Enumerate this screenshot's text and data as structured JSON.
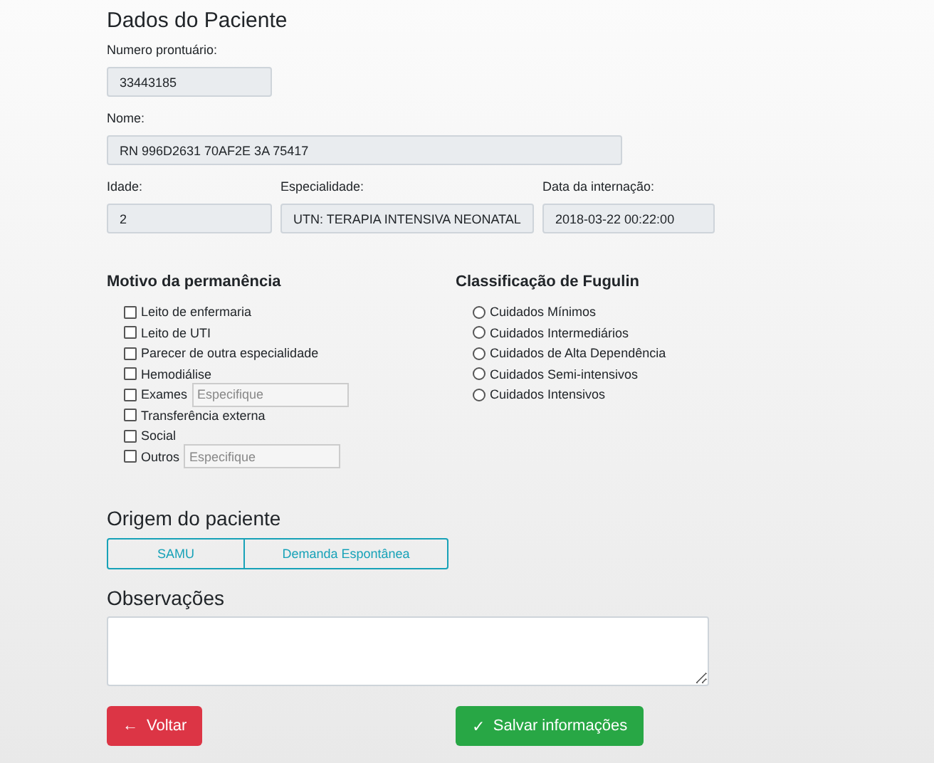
{
  "title": "Dados do Paciente",
  "fields": [
    {
      "label": "Numero prontuário:",
      "value": "33443185"
    },
    {
      "label": "Nome:",
      "value": "RN 996D2631 70AF2E 3A 75417"
    }
  ],
  "fields_row": [
    {
      "label": "Idade:",
      "value": "2"
    },
    {
      "label": "Especialidade:",
      "value": "UTN: TERAPIA INTENSIVA NEONATAL"
    },
    {
      "label": "Data da internação:",
      "value": "2018-03-22 00:22:00"
    }
  ],
  "motivo": {
    "heading": "Motivo da permanência",
    "items": [
      {
        "label": "Leito de enfermaria",
        "checked": false,
        "kind": "checkbox"
      },
      {
        "label": "Leito de UTI",
        "checked": false,
        "kind": "checkbox"
      },
      {
        "label": "Parecer de outra especialidade",
        "checked": false,
        "kind": "checkbox"
      },
      {
        "label": "Hemodiálise",
        "checked": false,
        "kind": "checkbox"
      },
      {
        "label": "Exames",
        "checked": false,
        "kind": "with-field",
        "placeholder": "Especifique"
      },
      {
        "label": "Transferência externa",
        "checked": false,
        "kind": "checkbox"
      },
      {
        "label": "Social",
        "checked": false,
        "kind": "checkbox"
      },
      {
        "label": "Outros",
        "checked": false,
        "kind": "with-field",
        "placeholder": "Especifique"
      }
    ]
  },
  "fugulin": {
    "heading": "Classificação de Fugulin",
    "options": [
      {
        "label": "Cuidados Mínimos",
        "selected": false
      },
      {
        "label": "Cuidados Intermediários",
        "selected": false
      },
      {
        "label": "Cuidados de Alta Dependência",
        "selected": false
      },
      {
        "label": "Cuidados Semi-intensivos",
        "selected": false
      },
      {
        "label": "Cuidados Intensivos",
        "selected": false
      }
    ]
  },
  "origem": {
    "heading": "Origem do paciente",
    "options": [
      {
        "label": "SAMU",
        "selected": false
      },
      {
        "label": "Demanda Espontânea",
        "selected": false
      }
    ]
  },
  "observacoes": {
    "heading": "Observações"
  },
  "buttons": [
    {
      "label": "Voltar",
      "kind": "back",
      "icon": "←"
    },
    {
      "label": "Salvar informações",
      "kind": "save",
      "icon": "✓"
    }
  ]
}
